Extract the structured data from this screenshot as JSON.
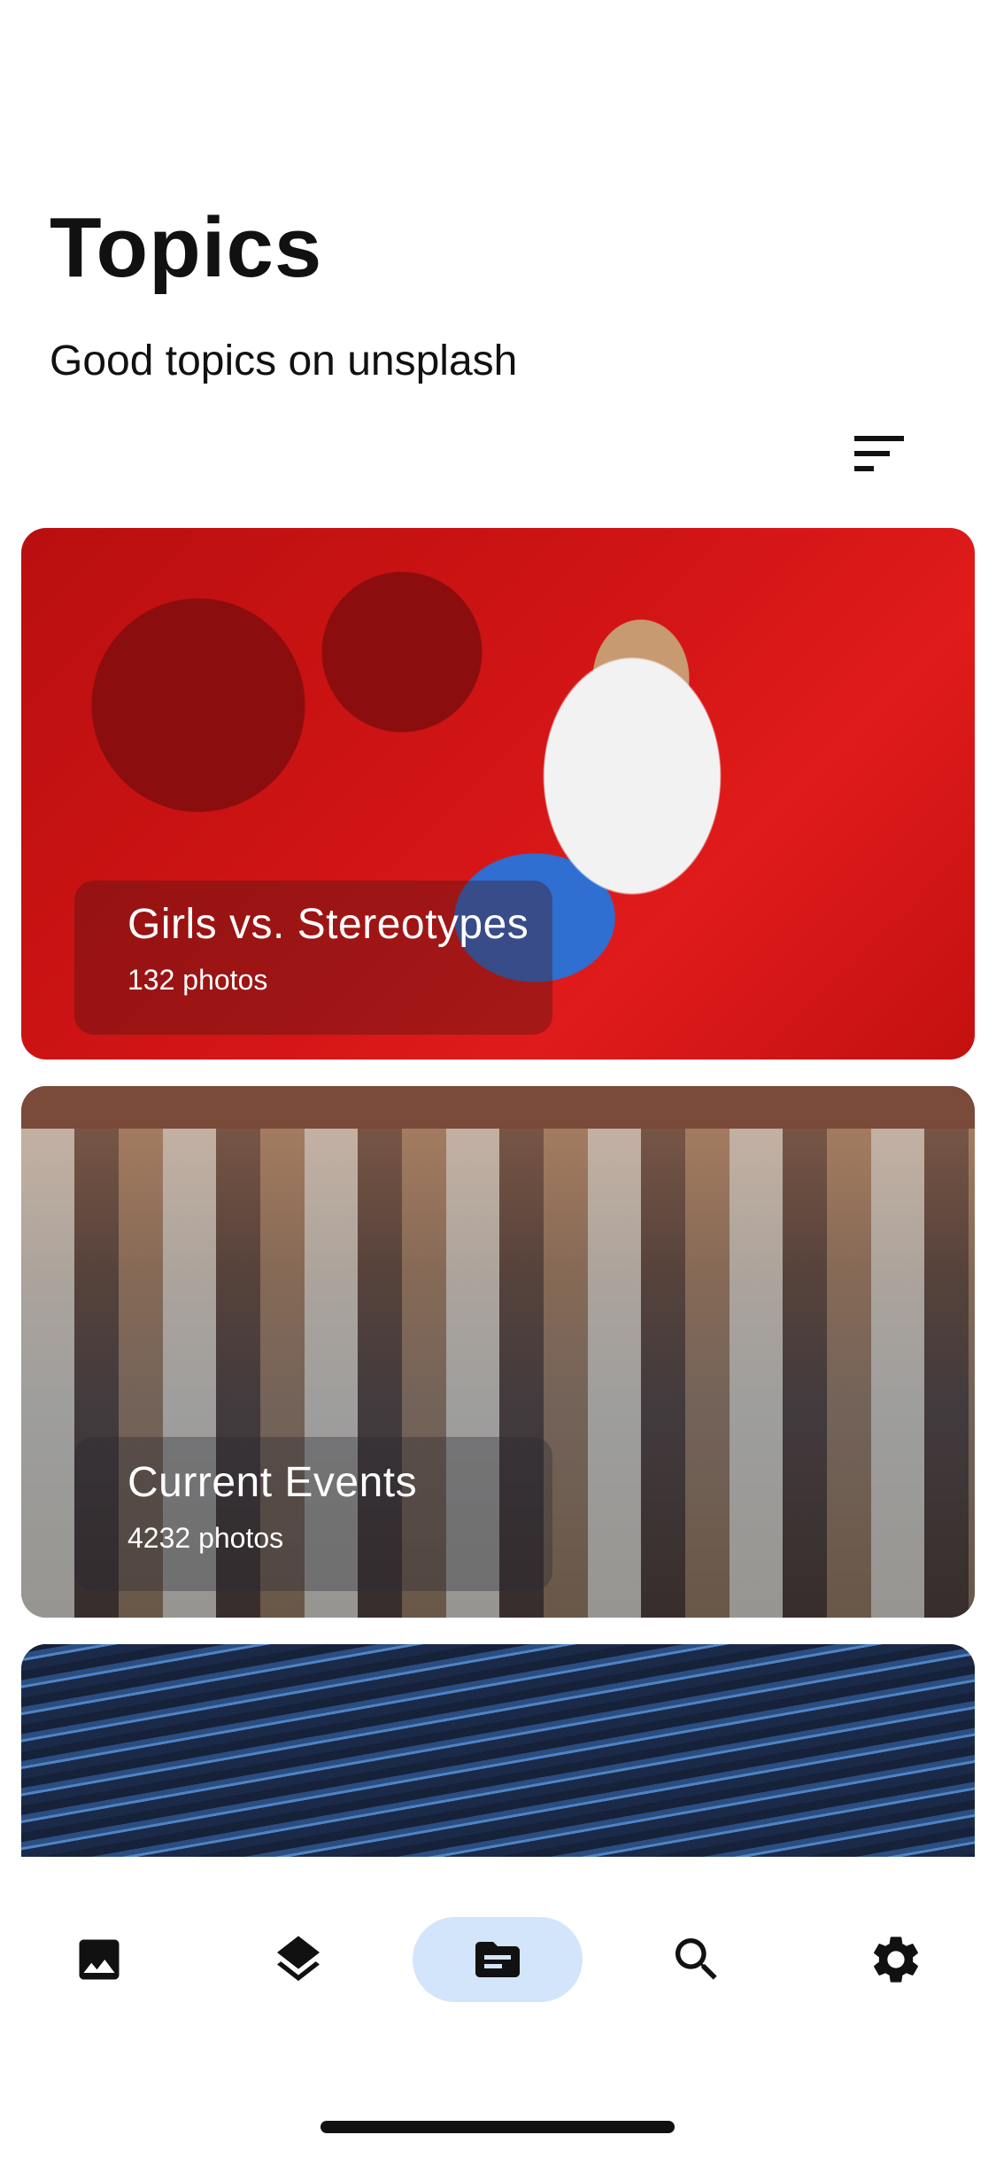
{
  "header": {
    "title": "Topics",
    "subtitle": "Good topics on unsplash"
  },
  "toolbar": {
    "sort_icon": "sort-icon"
  },
  "topics": [
    {
      "title": "Girls vs. Stereotypes",
      "count": "132 photos"
    },
    {
      "title": "Current Events",
      "count": "4232 photos"
    },
    {
      "title": "",
      "count": ""
    }
  ],
  "nav": {
    "items": [
      {
        "icon": "image-icon",
        "active": false
      },
      {
        "icon": "layers-icon",
        "active": false
      },
      {
        "icon": "topics-icon",
        "active": true
      },
      {
        "icon": "search-icon",
        "active": false
      },
      {
        "icon": "settings-icon",
        "active": false
      }
    ],
    "active_color": "#d3e5fb"
  }
}
